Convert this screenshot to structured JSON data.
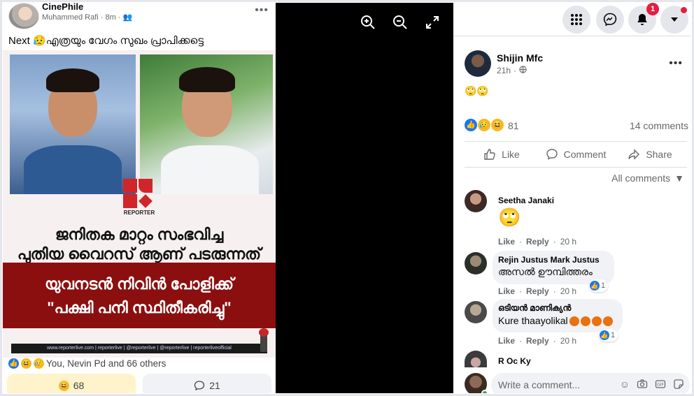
{
  "left_post": {
    "page_name": "CinePhile",
    "author": "Muhammed Rafi",
    "time": "8m",
    "text": "Next 😥എത്രയും വേഗം സുഖം പ്രാപിക്കട്ടെ",
    "image": {
      "logo_text": "REPORTER",
      "headline_1_line_1": "ജനിതക മാറ്റം സംഭവിച്ച",
      "headline_1_line_2": "പുതിയ വൈറസ് ആണ് പടരുന്നത്",
      "headline_2_line_1": "യുവനടൻ നിവിൻ പോളിക്ക്",
      "headline_2_line_2": "\"പക്ഷി പനി സ്ഥിതീകരിച്ചു\"",
      "footer": "www.reporterlive.com  |  reporterlive  |  @reporterlive  |  @reporterlive  |  reporterliveofficial"
    },
    "reactions_text": "You, Nevin Pd and 66 others",
    "haha_count": "68",
    "comment_count": "21"
  },
  "right_post": {
    "author": "Shijin Mfc",
    "time": "21h",
    "text": "🙄🙄",
    "reaction_count": "81",
    "comments_label": "14 comments",
    "actions": {
      "like": "Like",
      "comment": "Comment",
      "share": "Share"
    },
    "sort_label": "All comments",
    "comments": [
      {
        "name": "Seetha Janaki",
        "text": "🙄",
        "like": "Like",
        "reply": "Reply",
        "time": "20 h"
      },
      {
        "name": "Rejin Justus Mark Justus",
        "text": "അസൽ ഊമ്പിത്തരം",
        "like": "Like",
        "reply": "Reply",
        "time": "20 h",
        "reactions": "1"
      },
      {
        "name": "ഒടിയൻ മാണിക്യൻ",
        "text": "Kure thaayolikal",
        "like": "Like",
        "reply": "Reply",
        "time": "20 h",
        "reactions": "1"
      },
      {
        "name": "R Oc Ky"
      }
    ],
    "write_placeholder": "Write a comment..."
  },
  "top_nav": {
    "notifications_badge": "1"
  },
  "colors": {
    "fb_blue": "#1877f2",
    "badge_red": "#e41e3f",
    "reporter_red": "#8c0f0f"
  }
}
